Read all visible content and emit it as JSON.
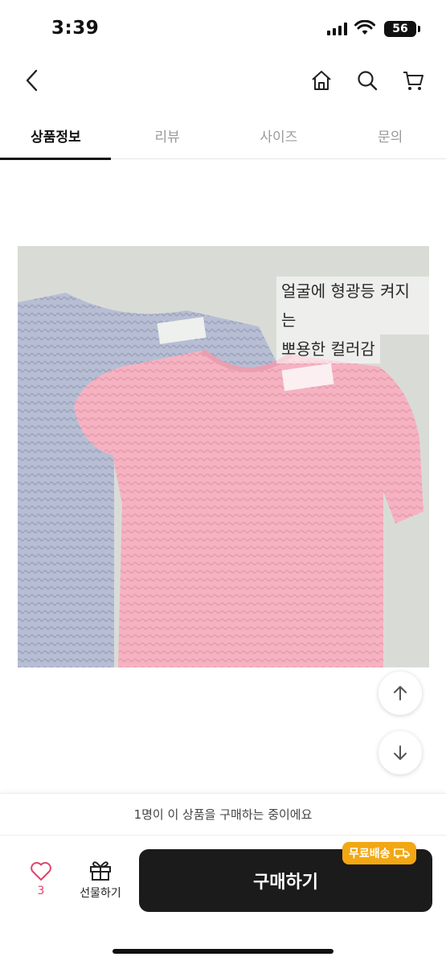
{
  "status_bar": {
    "time": "3:39",
    "battery": "56"
  },
  "nav": {
    "icons": {
      "back": "chevron-left-icon",
      "home": "home-icon",
      "search": "search-icon",
      "cart": "cart-icon"
    }
  },
  "tabs": [
    {
      "label": "상품정보",
      "active": true
    },
    {
      "label": "리뷰",
      "active": false
    },
    {
      "label": "사이즈",
      "active": false
    },
    {
      "label": "문의",
      "active": false
    }
  ],
  "product_image": {
    "caption_line1": "얼굴에 형광등 켜지는",
    "caption_line2": "뽀용한 컬러감",
    "colors": {
      "background": "#d9dcd6",
      "pink_knit": "#f5b3c2",
      "blue_knit": "#b7bed4"
    }
  },
  "viewer_notice": "1명이 이 상품을 구매하는 중이에요",
  "actions": {
    "like_count": "3",
    "gift_label": "선물하기",
    "buy_label": "구매하기",
    "free_shipping_badge": "무료배송"
  },
  "colors": {
    "accent_pink": "#e0436b",
    "buy_button": "#1b1b1b",
    "shipping_badge": "#f2a713"
  }
}
